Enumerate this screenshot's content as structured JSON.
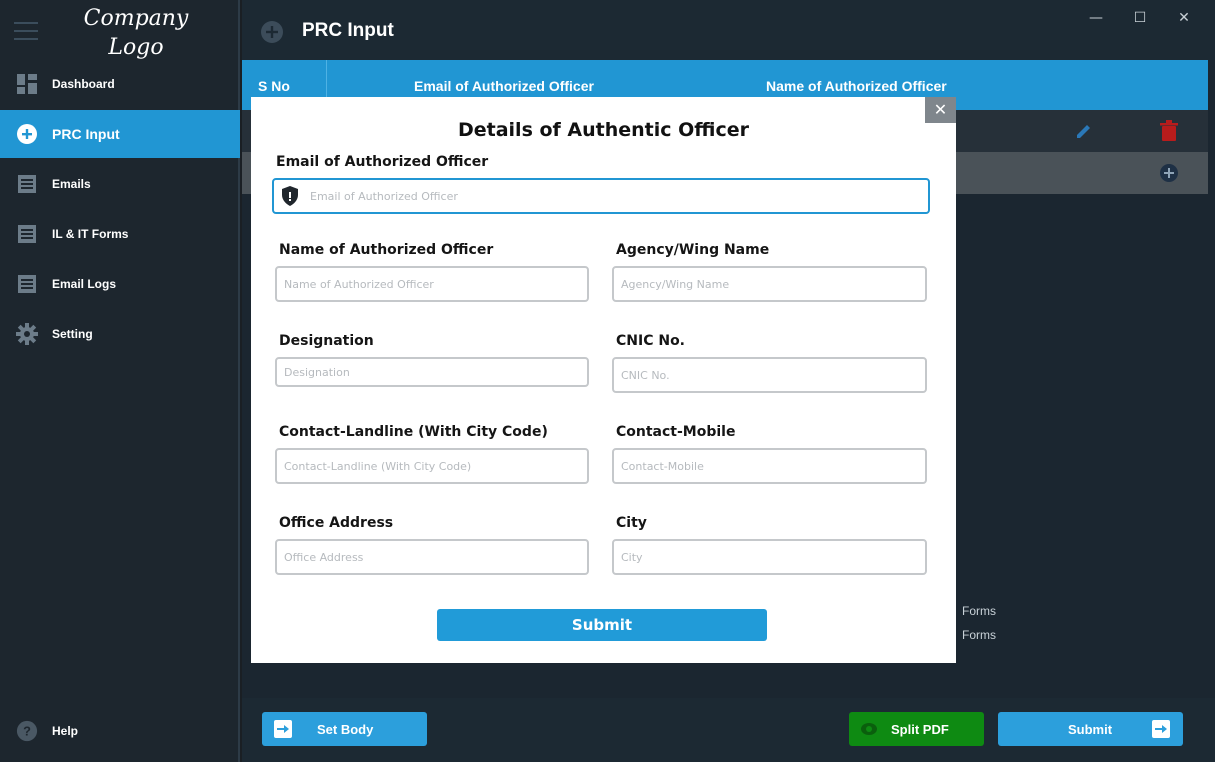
{
  "sidebar": {
    "logo_line1": "Company",
    "logo_line2": "Logo",
    "items": [
      {
        "label": "Dashboard",
        "icon": "dashboard-icon"
      },
      {
        "label": "PRC Input",
        "icon": "plus-circle-icon",
        "active": true
      },
      {
        "label": "Emails",
        "icon": "list-icon"
      },
      {
        "label": "IL & IT Forms",
        "icon": "list-icon"
      },
      {
        "label": "Email Logs",
        "icon": "list-icon"
      },
      {
        "label": "Setting",
        "icon": "gear-icon"
      }
    ],
    "help_label": "Help"
  },
  "header": {
    "title": "PRC Input",
    "window_controls": [
      "—",
      "☐",
      "✕"
    ]
  },
  "table": {
    "columns": [
      "S No",
      "Email of Authorized Officer",
      "Name of Authorized Officer"
    ]
  },
  "background": {
    "forms_1": "Forms",
    "forms_2": "Forms"
  },
  "bottom": {
    "set_body_label": "Set Body",
    "split_pdf_label": "Split PDF",
    "submit_label": "Submit"
  },
  "modal": {
    "title": "Details of Authentic Officer",
    "close": "✕",
    "fields": {
      "email": {
        "label": "Email of Authorized Officer",
        "placeholder": "Email of Authorized Officer"
      },
      "name": {
        "label": "Name of Authorized Officer",
        "placeholder": "Name of Authorized Officer"
      },
      "agency": {
        "label": "Agency/Wing Name",
        "placeholder": "Agency/Wing Name"
      },
      "designation": {
        "label": "Designation",
        "placeholder": "Designation"
      },
      "cnic": {
        "label": "CNIC No.",
        "placeholder": "CNIC No."
      },
      "landline": {
        "label": "Contact-Landline (With City Code)",
        "placeholder": "Contact-Landline (With City Code)"
      },
      "mobile": {
        "label": "Contact-Mobile",
        "placeholder": "Contact-Mobile"
      },
      "address": {
        "label": "Office Address",
        "placeholder": "Office Address"
      },
      "city": {
        "label": "City",
        "placeholder": "City"
      }
    },
    "submit_label": "Submit"
  },
  "colors": {
    "accent": "#2196d3",
    "sidebar_bg": "#1d262e",
    "green": "#0e8a12",
    "delete_red": "#c21a1a"
  }
}
